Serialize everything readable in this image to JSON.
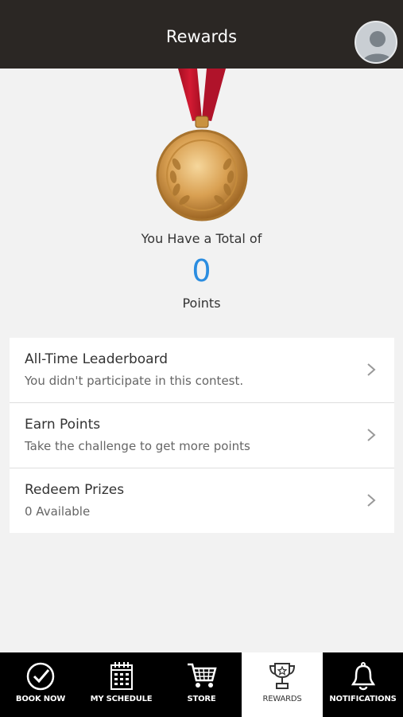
{
  "header": {
    "title": "Rewards"
  },
  "summary": {
    "total_label": "You Have a Total of",
    "points": "0",
    "points_label": "Points"
  },
  "menu": [
    {
      "title": "All-Time Leaderboard",
      "subtitle": "You didn't participate in this contest."
    },
    {
      "title": "Earn Points",
      "subtitle": "Take the challenge to get more points"
    },
    {
      "title": "Redeem Prizes",
      "subtitle": "0 Available"
    }
  ],
  "tabs": [
    {
      "label": "BOOK NOW",
      "icon": "check-circle-icon"
    },
    {
      "label": "MY SCHEDULE",
      "icon": "calendar-icon"
    },
    {
      "label": "STORE",
      "icon": "cart-icon"
    },
    {
      "label": "REWARDS",
      "icon": "trophy-icon",
      "active": true
    },
    {
      "label": "NOTIFICATIONS",
      "icon": "bell-icon"
    }
  ],
  "colors": {
    "header_bg": "#2b2724",
    "points_accent": "#2b8de0",
    "tabbar_bg": "#000000",
    "ribbon": "#c0142a",
    "medal_gold": "#d9a052"
  }
}
